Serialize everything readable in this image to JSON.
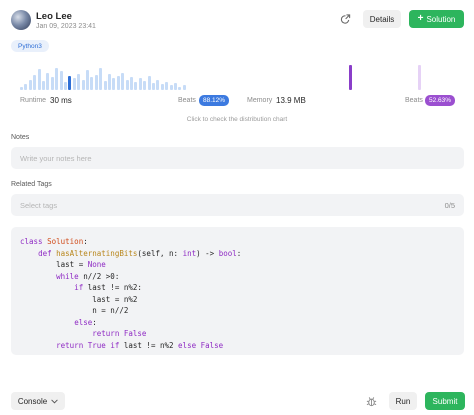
{
  "user": {
    "name": "Leo Lee",
    "date": "Jan 09, 2023 23:41"
  },
  "toolbar": {
    "details_label": "Details",
    "solution_label": "Solution",
    "share_icon": "share-icon"
  },
  "language_tag": "Python3",
  "runtime": {
    "label": "Runtime",
    "value": "30 ms",
    "beats_label": "Beats",
    "beats_value": "88.12%",
    "color": "#3c7ae0",
    "distribution": [
      3,
      5,
      9,
      13,
      18,
      8,
      15,
      11,
      19,
      16,
      7,
      12,
      10,
      14,
      9,
      17,
      11,
      13,
      19,
      8,
      14,
      10,
      12,
      15,
      9,
      11,
      7,
      10,
      8,
      12,
      6,
      9,
      5,
      7,
      4,
      6,
      3,
      4
    ],
    "highlight_index": 11
  },
  "memory": {
    "label": "Memory",
    "value": "13.9 MB",
    "beats_label": "Beats",
    "beats_value": "52.63%",
    "color": "#9b4fd0"
  },
  "distribution_hint": "Click to check the distribution chart",
  "notes": {
    "label": "Notes",
    "placeholder": "Write your notes here"
  },
  "related_tags": {
    "label": "Related Tags",
    "placeholder": "Select tags",
    "count": "0/5"
  },
  "code_lines": [
    "class Solution:",
    "    def hasAlternatingBits(self, n: int) -> bool:",
    "        last = None",
    "        while n//2 >0:",
    "            if last != n%2:",
    "                last = n%2",
    "                n = n//2",
    "            else:",
    "                return False",
    "        return True if last != n%2 else False"
  ],
  "footer": {
    "console_label": "Console",
    "run_label": "Run",
    "submit_label": "Submit"
  }
}
